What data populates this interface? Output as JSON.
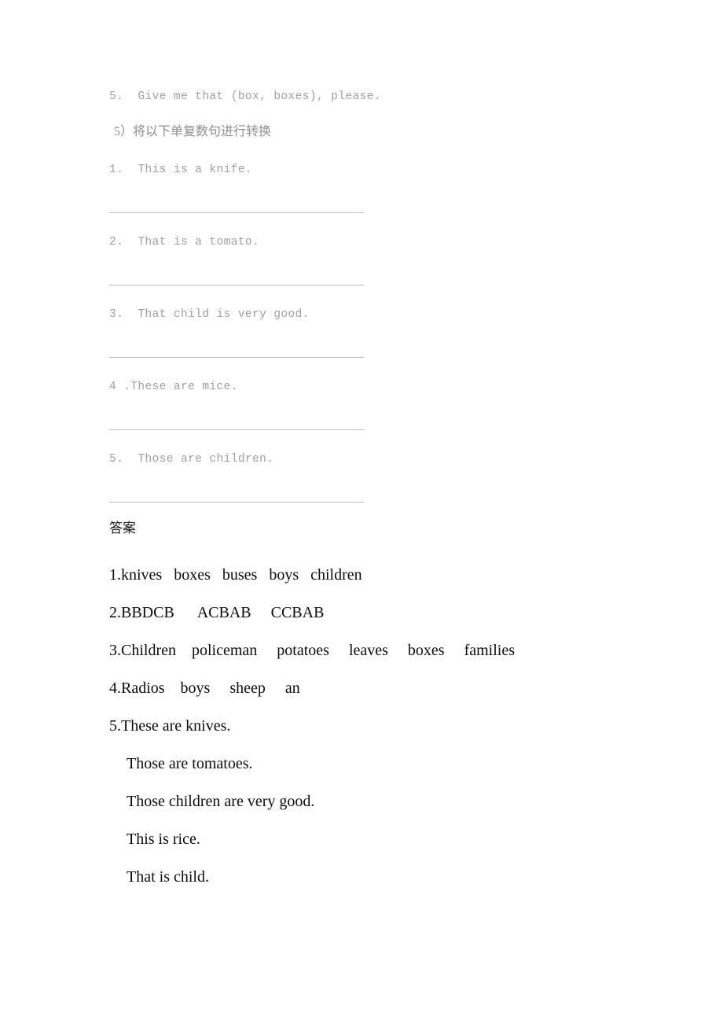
{
  "document": {
    "exercise": {
      "carryover_question": "5.  Give me that (box, boxes), please.",
      "section_heading": "5）将以下单复数句进行转换",
      "questions": [
        {
          "text": "1.  This is a knife."
        },
        {
          "text": "2.  That is a tomato."
        },
        {
          "text": "3.  That child is very good."
        },
        {
          "text": "4 .These are mice."
        },
        {
          "text": "5.  Those are children."
        }
      ]
    },
    "answer_key": {
      "heading": "答案",
      "lines": [
        {
          "text": "1.knives   boxes   buses   boys   children",
          "indented": false
        },
        {
          "text": "2.BBDCB      ACBAB     CCBAB",
          "indented": false
        },
        {
          "text": "3.Children    policeman     potatoes     leaves     boxes     families",
          "indented": false
        },
        {
          "text": "4.Radios    boys     sheep     an",
          "indented": false
        },
        {
          "text": "5.These are knives.",
          "indented": false
        },
        {
          "text": "Those are tomatoes.",
          "indented": true
        },
        {
          "text": "Those children are very good.",
          "indented": true
        },
        {
          "text": "This is rice.",
          "indented": true
        },
        {
          "text": "That is child.",
          "indented": true
        }
      ]
    }
  },
  "colors": {
    "page_background": "#ffffff",
    "exercise_text": "#a0a0a0",
    "answer_rule": "#bdbdbd",
    "answer_text": "#0d0d0d",
    "heading_text": "#1a1a1a"
  }
}
